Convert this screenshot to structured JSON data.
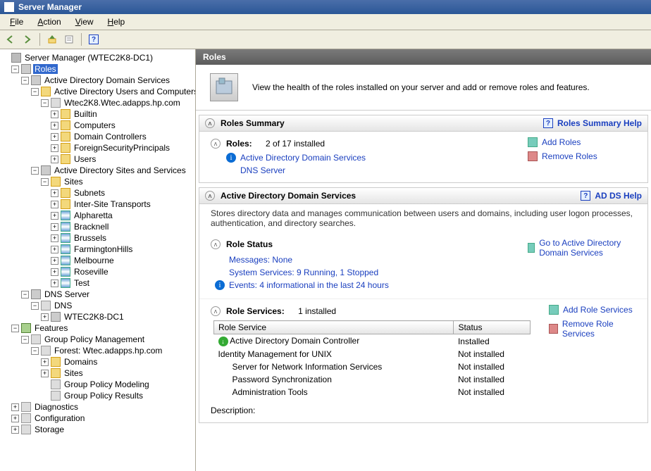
{
  "window": {
    "title": "Server Manager"
  },
  "menu": {
    "file": "File",
    "action": "Action",
    "view": "View",
    "help": "Help"
  },
  "tree": {
    "root": "Server Manager (WTEC2K8-DC1)",
    "roles": "Roles",
    "adds": "Active Directory Domain Services",
    "aduc": "Active Directory Users and Computers",
    "domain": "Wtec2K8.Wtec.adapps.hp.com",
    "builtin": "Builtin",
    "computers": "Computers",
    "dcs": "Domain Controllers",
    "fsp": "ForeignSecurityPrincipals",
    "users": "Users",
    "adss": "Active Directory Sites and Services",
    "sites": "Sites",
    "subnets": "Subnets",
    "ist": "Inter-Site Transports",
    "s1": "Alpharetta",
    "s2": "Bracknell",
    "s3": "Brussels",
    "s4": "FarmingtonHills",
    "s5": "Melbourne",
    "s6": "Roseville",
    "s7": "Test",
    "dns": "DNS Server",
    "dnsn": "DNS",
    "dnshost": "WTEC2K8-DC1",
    "features": "Features",
    "gpm": "Group Policy Management",
    "forest": "Forest: Wtec.adapps.hp.com",
    "domains": "Domains",
    "gsites": "Sites",
    "gpmodel": "Group Policy Modeling",
    "gpresults": "Group Policy Results",
    "diag": "Diagnostics",
    "config": "Configuration",
    "storage": "Storage"
  },
  "content": {
    "header": "Roles",
    "intro": "View the health of the roles installed on your server and add or remove roles and features.",
    "summary": {
      "title": "Roles Summary",
      "help": "Roles Summary Help",
      "roles_label": "Roles:",
      "roles_count": "2 of 17 installed",
      "r1": "Active Directory Domain Services",
      "r2": "DNS Server",
      "add": "Add Roles",
      "remove": "Remove Roles"
    },
    "adds": {
      "title": "Active Directory Domain Services",
      "help": "AD DS Help",
      "desc": "Stores directory data and manages communication between users and domains, including user logon processes, authentication, and directory searches.",
      "status_title": "Role Status",
      "msg_l": "Messages:",
      "msg_v": "None",
      "svc_l": "System Services:",
      "svc_v": "9 Running, 1 Stopped",
      "evt_l": "Events:",
      "evt_v": "4 informational in the last 24 hours",
      "goto": "Go to Active Directory Domain Services",
      "rsvc_title": "Role Services:",
      "rsvc_count": "1 installed",
      "add_rs": "Add Role Services",
      "rem_rs": "Remove Role Services",
      "th1": "Role Service",
      "th2": "Status",
      "rows": [
        {
          "n": "Active Directory Domain Controller",
          "s": "Installed",
          "i": 0,
          "ok": true
        },
        {
          "n": "Identity Management for UNIX",
          "s": "Not installed",
          "i": 0
        },
        {
          "n": "Server for Network Information Services",
          "s": "Not installed",
          "i": 1
        },
        {
          "n": "Password Synchronization",
          "s": "Not installed",
          "i": 1
        },
        {
          "n": "Administration Tools",
          "s": "Not installed",
          "i": 1
        }
      ],
      "desc_label": "Description:"
    }
  }
}
